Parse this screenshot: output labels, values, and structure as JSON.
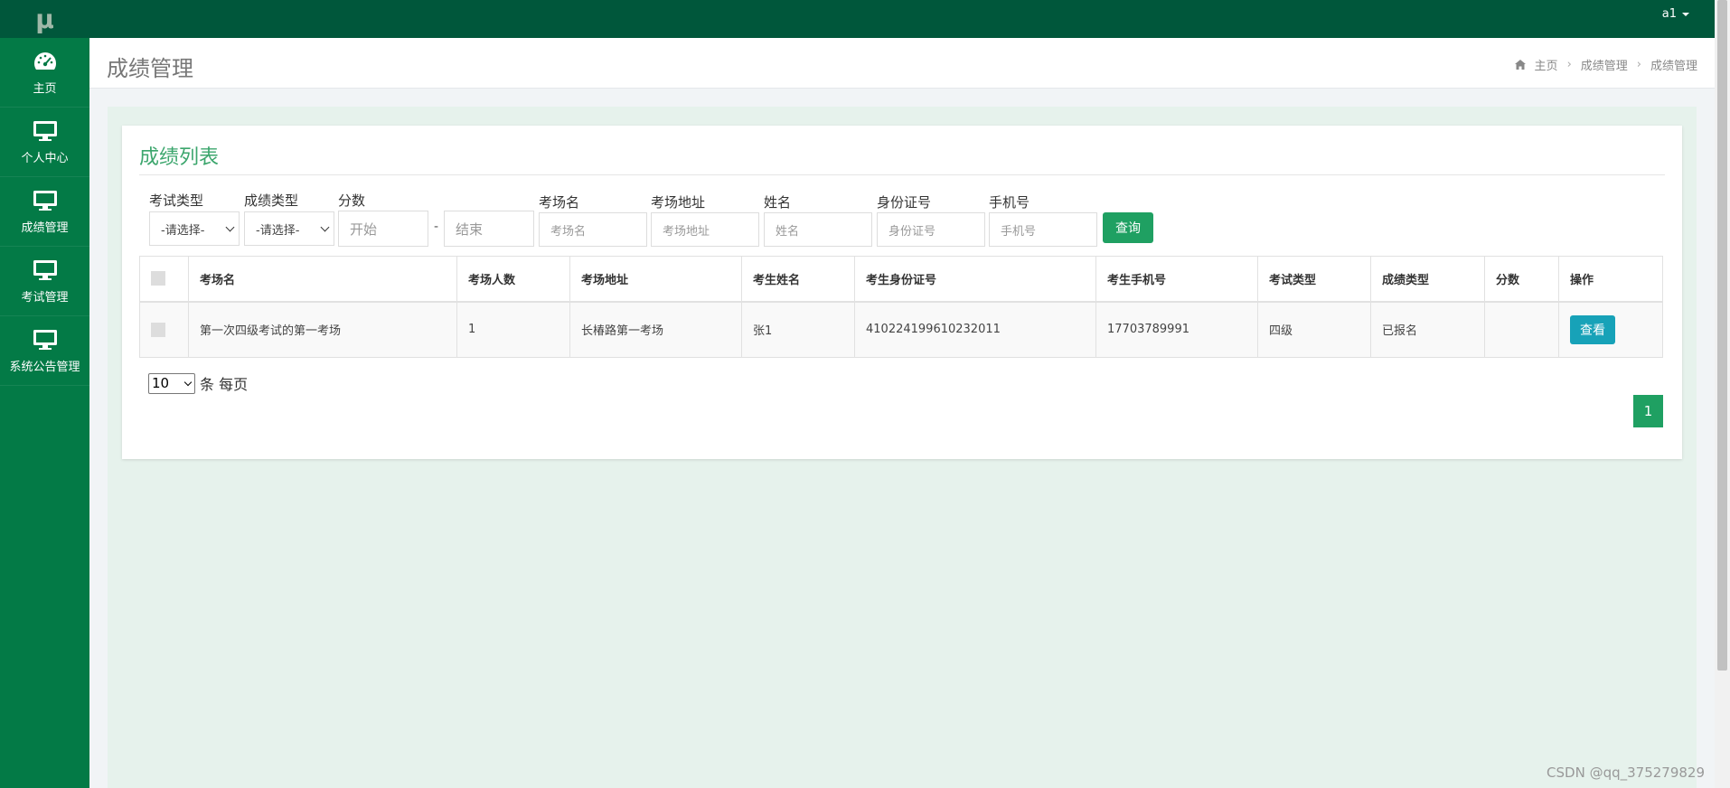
{
  "app": {
    "logo": "μ",
    "user": "a1"
  },
  "sidebar": {
    "items": [
      {
        "label": "主页",
        "icon": "dashboard-icon"
      },
      {
        "label": "个人中心",
        "icon": "monitor-icon"
      },
      {
        "label": "成绩管理",
        "icon": "monitor-icon"
      },
      {
        "label": "考试管理",
        "icon": "monitor-icon"
      },
      {
        "label": "系统公告管理",
        "icon": "monitor-icon"
      }
    ]
  },
  "header": {
    "title": "成绩管理",
    "breadcrumb": [
      "主页",
      "成绩管理",
      "成绩管理"
    ]
  },
  "card": {
    "title": "成绩列表"
  },
  "filters": {
    "exam_type_label": "考试类型",
    "exam_type_value": "-请选择-",
    "score_type_label": "成绩类型",
    "score_type_value": "-请选择-",
    "score_label": "分数",
    "score_start_placeholder": "开始",
    "score_sep": "-",
    "score_end_placeholder": "结束",
    "venue_label": "考场名",
    "venue_placeholder": "考场名",
    "address_label": "考场地址",
    "address_placeholder": "考场地址",
    "name_label": "姓名",
    "name_placeholder": "姓名",
    "id_label": "身份证号",
    "id_placeholder": "身份证号",
    "phone_label": "手机号",
    "phone_placeholder": "手机号",
    "query_button": "查询"
  },
  "table": {
    "headers": [
      "考场名",
      "考场人数",
      "考场地址",
      "考生姓名",
      "考生身份证号",
      "考生手机号",
      "考试类型",
      "成绩类型",
      "分数",
      "操作"
    ],
    "rows": [
      {
        "venue": "第一次四级考试的第一考场",
        "count": "1",
        "address": "长椿路第一考场",
        "name": "张1",
        "id_number": "410224199610232011",
        "phone": "17703789991",
        "exam_type": "四级",
        "score_type": "已报名",
        "score": "",
        "action": "查看"
      }
    ]
  },
  "pagination": {
    "page_size": "10",
    "page_size_suffix": "条 每页",
    "current_page": "1"
  },
  "watermark": "CSDN @qq_375279829",
  "colors": {
    "sidebar": "#037a46",
    "topbar": "#00573b",
    "accent": "#1fa062",
    "info": "#17a2b8",
    "card_title": "#3ca66d"
  }
}
